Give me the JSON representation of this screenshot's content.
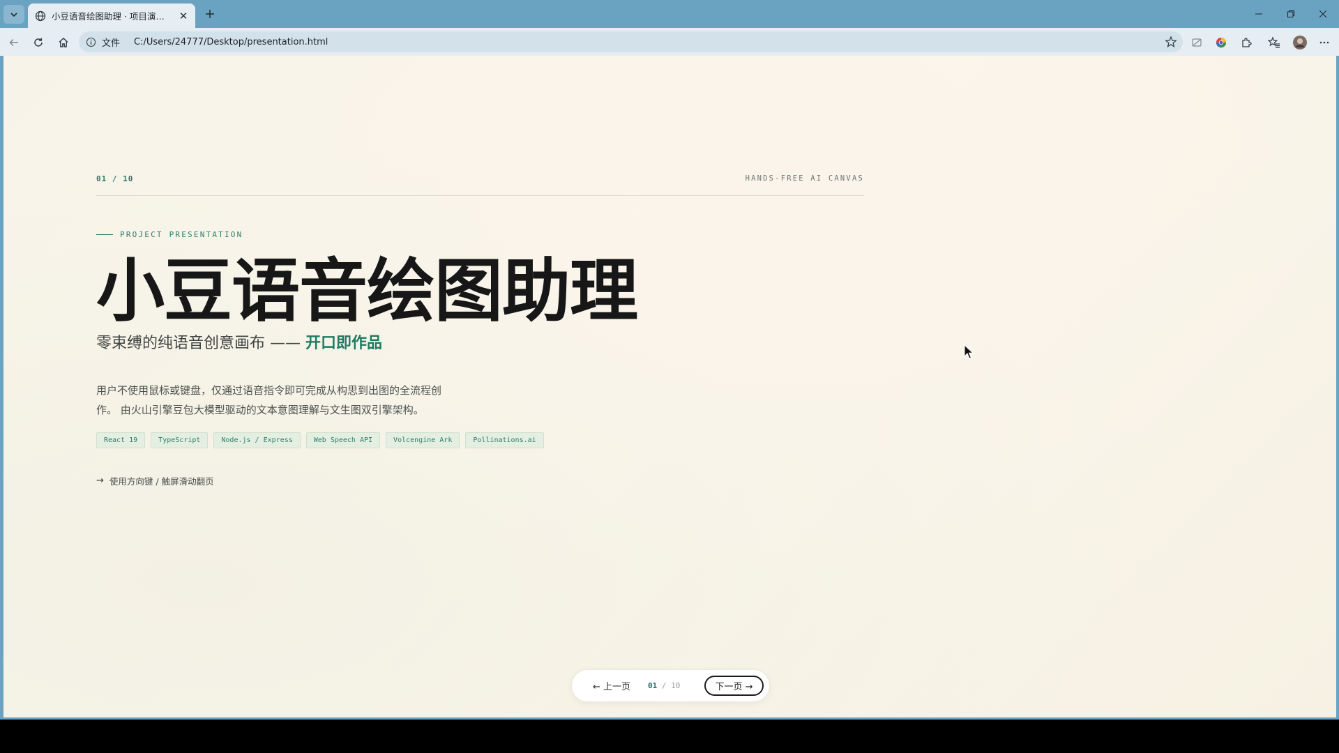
{
  "browser": {
    "tab_title": "小豆语音绘图助理 · 项目演示文稿",
    "url_scheme": "文件",
    "url": "C:/Users/24777/Desktop/presentation.html",
    "icons": [
      "tab-menu-icon",
      "globe-icon",
      "close-icon",
      "plus-icon",
      "back-icon",
      "reload-icon",
      "home-icon",
      "info-icon",
      "star-icon",
      "reading-icon",
      "color-icon",
      "extensions-icon",
      "favorites-icon",
      "profile-icon",
      "more-icon"
    ]
  },
  "slide": {
    "counter": "01 / 10",
    "tagline": "HANDS-FREE AI CANVAS",
    "eyebrow": "PROJECT PRESENTATION",
    "headline": "小豆语音绘图助理",
    "subline_prefix": "零束缚的纯语音创意画布 —— ",
    "subline_accent": "开口即作品",
    "description": "用户不使用鼠标或键盘，仅通过语音指令即可完成从构思到出图的全流程创作。 由火山引擎豆包大模型驱动的文本意图理解与文生图双引擎架构。",
    "chips": [
      "React 19",
      "TypeScript",
      "Node.js / Express",
      "Web Speech API",
      "Volcengine Ark",
      "Pollinations.ai"
    ],
    "hint_arrow": "→",
    "hint": "使用方向键 / 触屏滑动翻页"
  },
  "pager": {
    "prev": "← 上一页",
    "current": "01",
    "separator": "/",
    "total": "10",
    "next": "下一页 →"
  },
  "colors": {
    "accent": "#1f7a63",
    "headline": "#161716",
    "background": "#f8f4ea",
    "chrome": "#6aa3c2"
  }
}
